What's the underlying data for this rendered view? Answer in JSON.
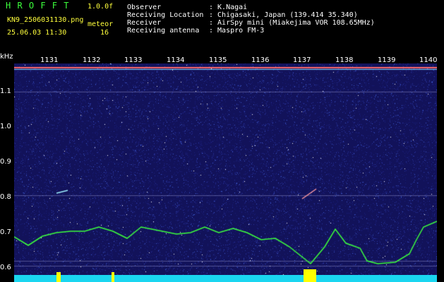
{
  "app": {
    "logo": "H R O F F T",
    "version": "1.0.0f",
    "filename": "KN9_2506031130.png",
    "timestamp": "25.06.03 11:30",
    "meteor_label": "meteor",
    "meteor_count": "16"
  },
  "info": {
    "rows": [
      {
        "label": "Observer",
        "value": ": K.Nagai"
      },
      {
        "label": "Receiving Location",
        "value": ": Chigasaki, Japan (139.414 35.340)"
      },
      {
        "label": "Receiver",
        "value": ": AirSpy mini (Miakejima VOR 108.65MHz)"
      },
      {
        "label": "Receiving antenna",
        "value": ": Maspro FM-3"
      }
    ]
  },
  "axes": {
    "y_unit": "kHz",
    "y_ticks": [
      "1.1",
      "1.0",
      "0.9",
      "0.8",
      "0.7",
      "0.6"
    ],
    "x_ticks": [
      "1131",
      "1132",
      "1133",
      "1134",
      "1135",
      "1136",
      "1137",
      "1138",
      "1139",
      "1140"
    ]
  },
  "colors": {
    "background": "#000000",
    "spectrogram_base": "#141464",
    "noise_line": "#3cff3c",
    "bottom_bar": "#1ad6f0",
    "meteor_echo": "#ffffff"
  },
  "chart_data": {
    "type": "heatmap",
    "x_range": [
      1130.8,
      1140.2
    ],
    "y_range": [
      0.58,
      1.17
    ],
    "y_unit": "kHz"
  }
}
